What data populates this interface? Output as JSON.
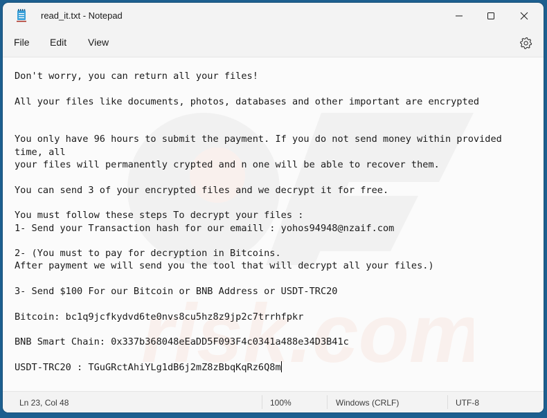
{
  "window": {
    "title": "read_it.txt - Notepad",
    "app_icon": "notepad-icon",
    "controls": {
      "minimize": "minimize-icon",
      "maximize": "maximize-icon",
      "close": "close-icon"
    }
  },
  "menu": {
    "items": [
      {
        "label": "File"
      },
      {
        "label": "Edit"
      },
      {
        "label": "View"
      }
    ],
    "settings_icon": "gear-icon"
  },
  "editor": {
    "lines": [
      "Don't worry, you can return all your files!",
      "",
      "All your files like documents, photos, databases and other important are encrypted",
      "",
      "",
      "You only have 96 hours to submit the payment. If you do not send money within provided time, all",
      "your files will permanently crypted and n one will be able to recover them.",
      "",
      "You can send 3 of your encrypted files and we decrypt it for free.",
      "",
      "You must follow these steps To decrypt your files :",
      "1- Send your Transaction hash for our emaill : yohos94948@nzaif.com",
      "",
      "2- (You must to pay for decryption in Bitcoins.",
      "After payment we will send you the tool that will decrypt all your files.)",
      "",
      "3- Send $100 For our Bitcoin or BNB Address or USDT-TRC20",
      "",
      "Bitcoin: bc1q9jcfkydvd6te0nvs8cu5hz8z9jp2c7trrhfpkr",
      "",
      "BNB Smart Chain: 0x337b368048eEaDD5F093F4c0341a488e34D3B41c",
      "",
      "USDT-TRC20 : TGuGRctAhiYLg1dB6j2mZ8zBbqKqRz6Q8m"
    ]
  },
  "status": {
    "position": "Ln 23, Col 48",
    "zoom": "100%",
    "line_ending": "Windows (CRLF)",
    "encoding": "UTF-8"
  }
}
